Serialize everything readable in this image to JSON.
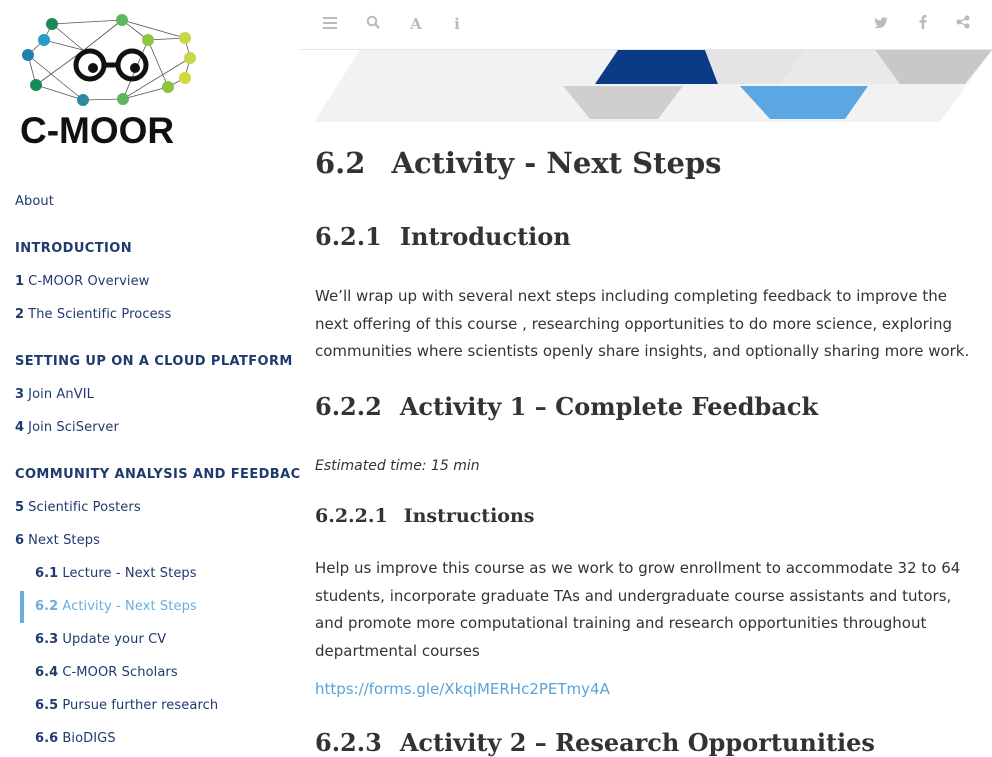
{
  "logo": {
    "text": "C-MOOR"
  },
  "sidebar": {
    "about": "About",
    "sections": [
      {
        "header": "INTRODUCTION"
      },
      {
        "header": "SETTING UP ON A CLOUD PLATFORM"
      },
      {
        "header": "COMMUNITY ANALYSIS AND FEEDBACK"
      }
    ],
    "items": [
      {
        "num": "1",
        "label": "C-MOOR Overview"
      },
      {
        "num": "2",
        "label": "The Scientific Process"
      },
      {
        "num": "3",
        "label": "Join AnVIL"
      },
      {
        "num": "4",
        "label": "Join SciServer"
      },
      {
        "num": "5",
        "label": "Scientific Posters"
      },
      {
        "num": "6",
        "label": "Next Steps"
      },
      {
        "num": "6.1",
        "label": "Lecture - Next Steps"
      },
      {
        "num": "6.2",
        "label": "Activity - Next Steps"
      },
      {
        "num": "6.3",
        "label": "Update your CV"
      },
      {
        "num": "6.4",
        "label": "C-MOOR Scholars"
      },
      {
        "num": "6.5",
        "label": "Pursue further research"
      },
      {
        "num": "6.6",
        "label": "BioDIGS"
      }
    ]
  },
  "toolbar": {
    "left": [
      "menu-icon",
      "search-icon",
      "font-icon",
      "info-icon"
    ],
    "right": [
      "twitter-icon",
      "facebook-icon",
      "share-icon"
    ]
  },
  "content": {
    "h1_num": "6.2",
    "h1_title": "Activity - Next Steps",
    "s1_num": "6.2.1",
    "s1_title": "Introduction",
    "s1_text": "We’ll wrap up with several next steps including completing feedback to improve the next offering of this course , researching opportunities to do more science, exploring communities where scientists openly share insights, and optionally sharing more work.",
    "s2_num": "6.2.2",
    "s2_title": "Activity 1 – Complete Feedback",
    "s2_time": "Estimated time: 15 min",
    "s3_num": "6.2.2.1",
    "s3_title": "Instructions",
    "s3_text": "Help us improve this course as we work to grow enrollment to accommodate 32 to 64 students, incorporate graduate TAs and undergraduate course assistants and tutors, and promote more computational training and research opportunities throughout departmental courses",
    "s3_link": "https://forms.gle/XkqiMERHc2PETmy4A",
    "s4_num": "6.2.3",
    "s4_title": "Activity 2 – Research Opportunities"
  },
  "colors": {
    "navy": "#1f3a6e",
    "accent": "#6aaee0",
    "link": "#5aa3d8",
    "text": "#333333"
  }
}
